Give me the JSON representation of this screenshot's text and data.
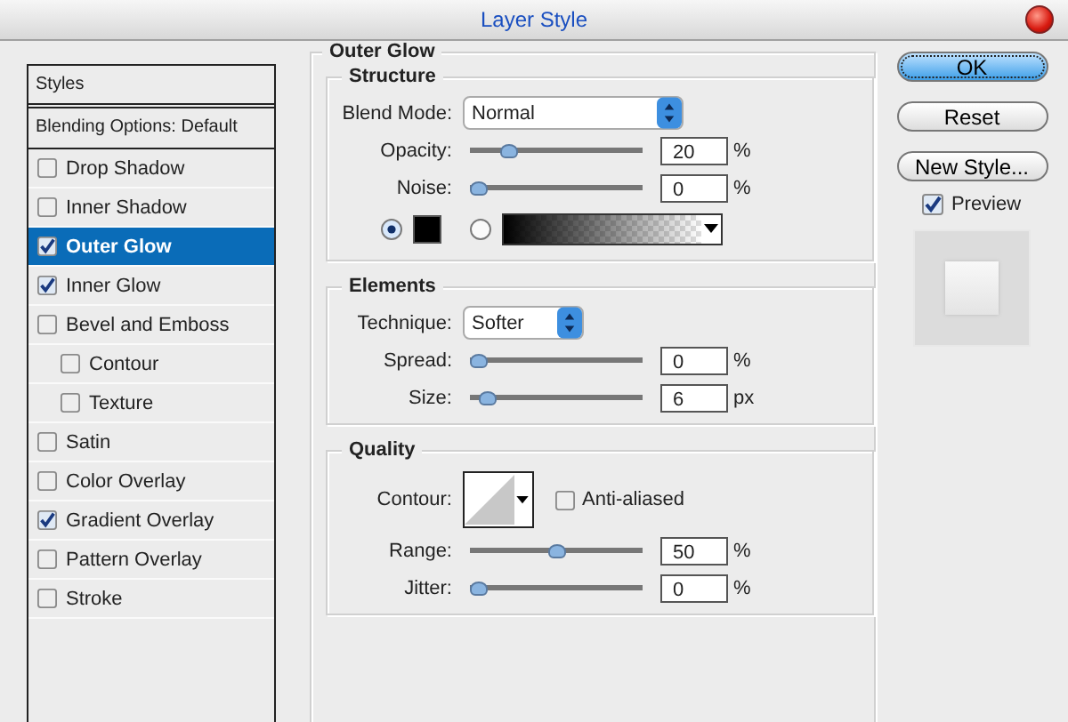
{
  "window": {
    "title": "Layer Style"
  },
  "styles_panel": {
    "header": "Styles",
    "blending_options": "Blending Options: Default",
    "items": [
      {
        "label": "Drop Shadow",
        "checked": false,
        "selected": false
      },
      {
        "label": "Inner Shadow",
        "checked": false,
        "selected": false
      },
      {
        "label": "Outer Glow",
        "checked": true,
        "selected": true
      },
      {
        "label": "Inner Glow",
        "checked": true,
        "selected": false
      },
      {
        "label": "Bevel and Emboss",
        "checked": false,
        "selected": false,
        "children": [
          {
            "label": "Contour",
            "checked": false,
            "selected": false
          },
          {
            "label": "Texture",
            "checked": false,
            "selected": false
          }
        ]
      },
      {
        "label": "Satin",
        "checked": false,
        "selected": false
      },
      {
        "label": "Color Overlay",
        "checked": false,
        "selected": false
      },
      {
        "label": "Gradient Overlay",
        "checked": true,
        "selected": false
      },
      {
        "label": "Pattern Overlay",
        "checked": false,
        "selected": false
      },
      {
        "label": "Stroke",
        "checked": false,
        "selected": false
      }
    ]
  },
  "settings": {
    "title": "Outer Glow",
    "sections": [
      {
        "title": "Structure",
        "rows": [
          {
            "kind": "select",
            "label": "Blend Mode:",
            "value": "Normal"
          },
          {
            "kind": "slider",
            "label": "Opacity:",
            "level": 0.2,
            "value": "20",
            "unit": "%"
          },
          {
            "kind": "slider",
            "label": "Noise:",
            "level": 0,
            "value": "0",
            "unit": "%"
          },
          {
            "kind": "fill",
            "color_selected": true,
            "gradient_selected": false
          }
        ]
      },
      {
        "title": "Elements",
        "rows": [
          {
            "kind": "select",
            "label": "Technique:",
            "value": "Softer"
          },
          {
            "kind": "slider",
            "label": "Spread:",
            "level": 0,
            "value": "0",
            "unit": "%"
          },
          {
            "kind": "slider",
            "label": "Size:",
            "level": 0.06,
            "value": "6",
            "unit": "px"
          }
        ]
      },
      {
        "title": "Quality",
        "rows": [
          {
            "kind": "contour",
            "label": "Contour:",
            "option": "Anti-aliased",
            "checked": false
          },
          {
            "kind": "slider",
            "label": "Range:",
            "level": 0.5,
            "value": "50",
            "unit": "%"
          },
          {
            "kind": "slider",
            "label": "Jitter:",
            "level": 0,
            "value": "0",
            "unit": "%"
          }
        ]
      }
    ]
  },
  "buttons": [
    {
      "label": "OK",
      "default": true
    },
    {
      "label": "Reset",
      "default": false
    },
    {
      "label": "New Style...",
      "default": false
    }
  ],
  "preview": {
    "label": "Preview",
    "checked": true
  }
}
